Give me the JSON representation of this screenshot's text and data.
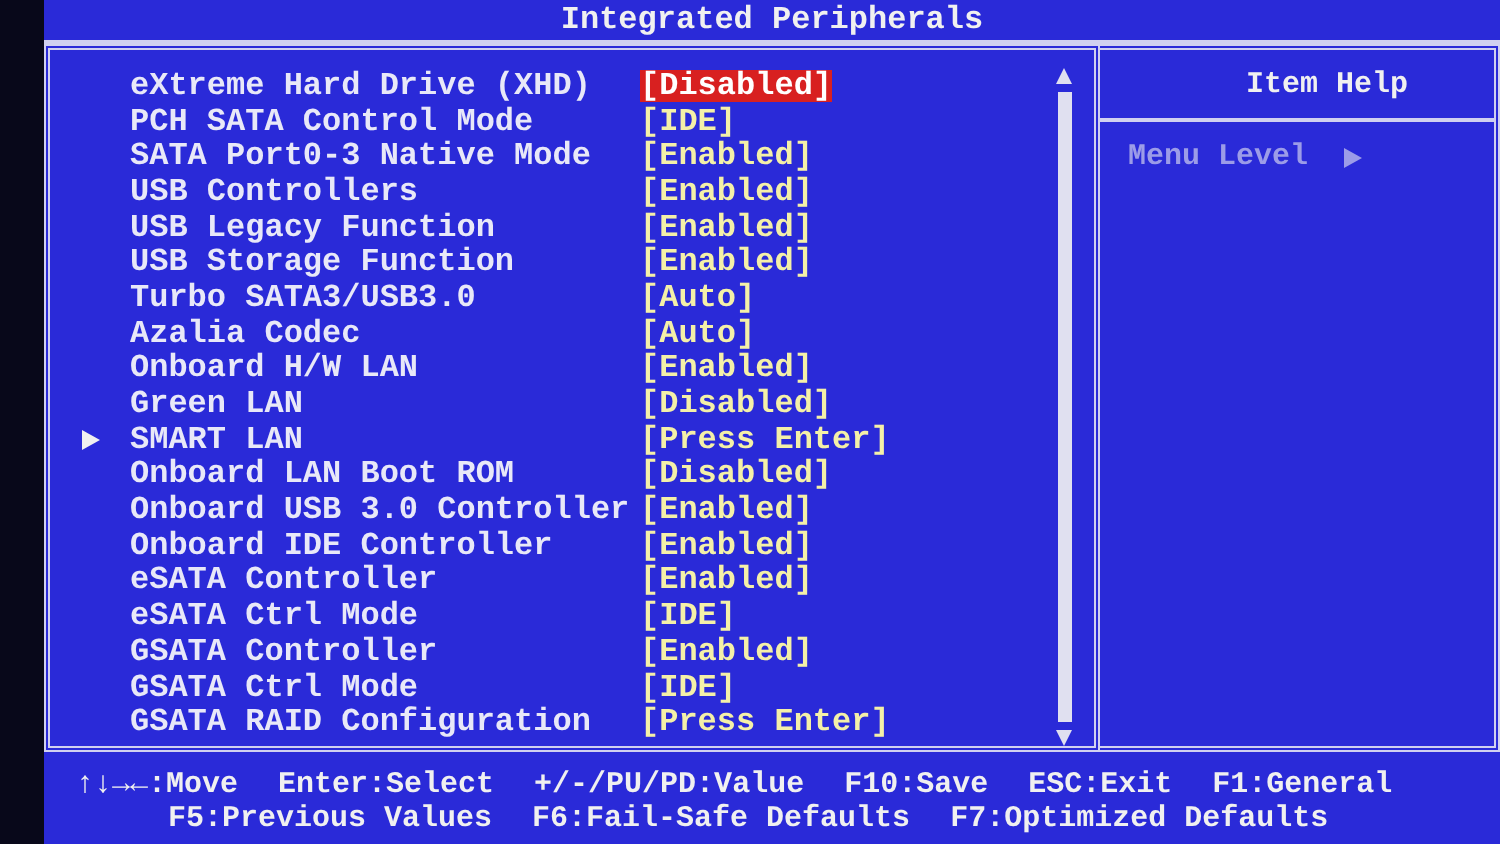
{
  "title": "Integrated Peripherals",
  "items": [
    {
      "label": "eXtreme Hard Drive (XHD)",
      "value": "[Disabled]",
      "selected": true,
      "kind": "setting"
    },
    {
      "label": "PCH SATA Control Mode",
      "value": "[IDE]",
      "selected": false,
      "kind": "setting"
    },
    {
      "label": "SATA Port0-3 Native Mode",
      "value": "[Enabled]",
      "selected": false,
      "kind": "setting"
    },
    {
      "label": "USB Controllers",
      "value": "[Enabled]",
      "selected": false,
      "kind": "setting"
    },
    {
      "label": "USB Legacy Function",
      "value": "[Enabled]",
      "selected": false,
      "kind": "setting"
    },
    {
      "label": "USB Storage Function",
      "value": "[Enabled]",
      "selected": false,
      "kind": "setting"
    },
    {
      "label": "Turbo SATA3/USB3.0",
      "value": "[Auto]",
      "selected": false,
      "kind": "setting"
    },
    {
      "label": "Azalia Codec",
      "value": "[Auto]",
      "selected": false,
      "kind": "setting"
    },
    {
      "label": "Onboard H/W LAN",
      "value": "[Enabled]",
      "selected": false,
      "kind": "setting"
    },
    {
      "label": "Green LAN",
      "value": "[Disabled]",
      "selected": false,
      "kind": "setting"
    },
    {
      "label": "SMART LAN",
      "value": "[Press Enter]",
      "selected": false,
      "kind": "submenu"
    },
    {
      "label": "Onboard LAN Boot ROM",
      "value": "[Disabled]",
      "selected": false,
      "kind": "setting"
    },
    {
      "label": "Onboard USB 3.0 Controller",
      "value": "[Enabled]",
      "selected": false,
      "kind": "setting"
    },
    {
      "label": "Onboard IDE Controller",
      "value": "[Enabled]",
      "selected": false,
      "kind": "setting"
    },
    {
      "label": "eSATA Controller",
      "value": "[Enabled]",
      "selected": false,
      "kind": "setting"
    },
    {
      "label": "eSATA Ctrl Mode",
      "value": "[IDE]",
      "selected": false,
      "kind": "setting"
    },
    {
      "label": "GSATA Controller",
      "value": "[Enabled]",
      "selected": false,
      "kind": "setting"
    },
    {
      "label": "GSATA Ctrl Mode",
      "value": "[IDE]",
      "selected": false,
      "kind": "setting"
    },
    {
      "label": "GSATA RAID Configuration",
      "value": "[Press Enter]",
      "selected": false,
      "kind": "setting"
    }
  ],
  "help": {
    "title": "Item Help",
    "menu_level": "Menu Level"
  },
  "key_hints": [
    [
      "↑↓→←:Move",
      "Enter:Select",
      "+/-/PU/PD:Value",
      "F10:Save",
      "ESC:Exit",
      "F1:General"
    ],
    [
      "F5:Previous Values",
      "F6:Fail-Safe Defaults",
      "F7:Optimized Defaults"
    ]
  ]
}
